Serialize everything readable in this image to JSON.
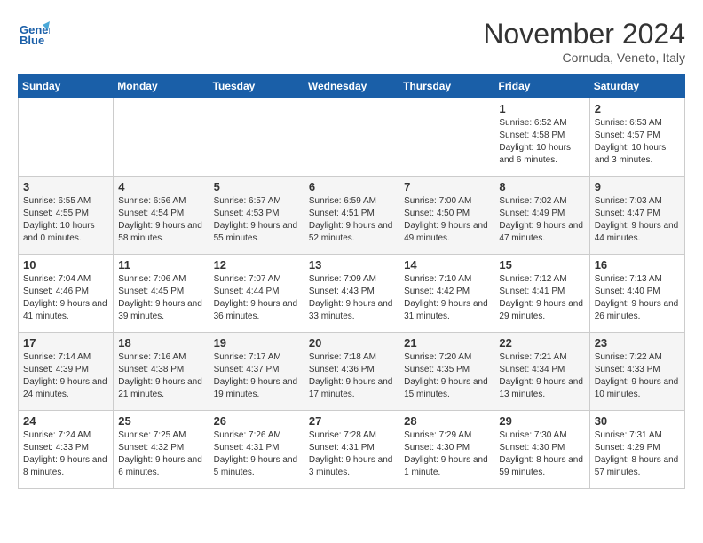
{
  "header": {
    "logo_line1": "General",
    "logo_line2": "Blue",
    "month_title": "November 2024",
    "location": "Cornuda, Veneto, Italy"
  },
  "weekdays": [
    "Sunday",
    "Monday",
    "Tuesday",
    "Wednesday",
    "Thursday",
    "Friday",
    "Saturday"
  ],
  "weeks": [
    [
      {
        "day": "",
        "info": ""
      },
      {
        "day": "",
        "info": ""
      },
      {
        "day": "",
        "info": ""
      },
      {
        "day": "",
        "info": ""
      },
      {
        "day": "",
        "info": ""
      },
      {
        "day": "1",
        "info": "Sunrise: 6:52 AM\nSunset: 4:58 PM\nDaylight: 10 hours and 6 minutes."
      },
      {
        "day": "2",
        "info": "Sunrise: 6:53 AM\nSunset: 4:57 PM\nDaylight: 10 hours and 3 minutes."
      }
    ],
    [
      {
        "day": "3",
        "info": "Sunrise: 6:55 AM\nSunset: 4:55 PM\nDaylight: 10 hours and 0 minutes."
      },
      {
        "day": "4",
        "info": "Sunrise: 6:56 AM\nSunset: 4:54 PM\nDaylight: 9 hours and 58 minutes."
      },
      {
        "day": "5",
        "info": "Sunrise: 6:57 AM\nSunset: 4:53 PM\nDaylight: 9 hours and 55 minutes."
      },
      {
        "day": "6",
        "info": "Sunrise: 6:59 AM\nSunset: 4:51 PM\nDaylight: 9 hours and 52 minutes."
      },
      {
        "day": "7",
        "info": "Sunrise: 7:00 AM\nSunset: 4:50 PM\nDaylight: 9 hours and 49 minutes."
      },
      {
        "day": "8",
        "info": "Sunrise: 7:02 AM\nSunset: 4:49 PM\nDaylight: 9 hours and 47 minutes."
      },
      {
        "day": "9",
        "info": "Sunrise: 7:03 AM\nSunset: 4:47 PM\nDaylight: 9 hours and 44 minutes."
      }
    ],
    [
      {
        "day": "10",
        "info": "Sunrise: 7:04 AM\nSunset: 4:46 PM\nDaylight: 9 hours and 41 minutes."
      },
      {
        "day": "11",
        "info": "Sunrise: 7:06 AM\nSunset: 4:45 PM\nDaylight: 9 hours and 39 minutes."
      },
      {
        "day": "12",
        "info": "Sunrise: 7:07 AM\nSunset: 4:44 PM\nDaylight: 9 hours and 36 minutes."
      },
      {
        "day": "13",
        "info": "Sunrise: 7:09 AM\nSunset: 4:43 PM\nDaylight: 9 hours and 33 minutes."
      },
      {
        "day": "14",
        "info": "Sunrise: 7:10 AM\nSunset: 4:42 PM\nDaylight: 9 hours and 31 minutes."
      },
      {
        "day": "15",
        "info": "Sunrise: 7:12 AM\nSunset: 4:41 PM\nDaylight: 9 hours and 29 minutes."
      },
      {
        "day": "16",
        "info": "Sunrise: 7:13 AM\nSunset: 4:40 PM\nDaylight: 9 hours and 26 minutes."
      }
    ],
    [
      {
        "day": "17",
        "info": "Sunrise: 7:14 AM\nSunset: 4:39 PM\nDaylight: 9 hours and 24 minutes."
      },
      {
        "day": "18",
        "info": "Sunrise: 7:16 AM\nSunset: 4:38 PM\nDaylight: 9 hours and 21 minutes."
      },
      {
        "day": "19",
        "info": "Sunrise: 7:17 AM\nSunset: 4:37 PM\nDaylight: 9 hours and 19 minutes."
      },
      {
        "day": "20",
        "info": "Sunrise: 7:18 AM\nSunset: 4:36 PM\nDaylight: 9 hours and 17 minutes."
      },
      {
        "day": "21",
        "info": "Sunrise: 7:20 AM\nSunset: 4:35 PM\nDaylight: 9 hours and 15 minutes."
      },
      {
        "day": "22",
        "info": "Sunrise: 7:21 AM\nSunset: 4:34 PM\nDaylight: 9 hours and 13 minutes."
      },
      {
        "day": "23",
        "info": "Sunrise: 7:22 AM\nSunset: 4:33 PM\nDaylight: 9 hours and 10 minutes."
      }
    ],
    [
      {
        "day": "24",
        "info": "Sunrise: 7:24 AM\nSunset: 4:33 PM\nDaylight: 9 hours and 8 minutes."
      },
      {
        "day": "25",
        "info": "Sunrise: 7:25 AM\nSunset: 4:32 PM\nDaylight: 9 hours and 6 minutes."
      },
      {
        "day": "26",
        "info": "Sunrise: 7:26 AM\nSunset: 4:31 PM\nDaylight: 9 hours and 5 minutes."
      },
      {
        "day": "27",
        "info": "Sunrise: 7:28 AM\nSunset: 4:31 PM\nDaylight: 9 hours and 3 minutes."
      },
      {
        "day": "28",
        "info": "Sunrise: 7:29 AM\nSunset: 4:30 PM\nDaylight: 9 hours and 1 minute."
      },
      {
        "day": "29",
        "info": "Sunrise: 7:30 AM\nSunset: 4:30 PM\nDaylight: 8 hours and 59 minutes."
      },
      {
        "day": "30",
        "info": "Sunrise: 7:31 AM\nSunset: 4:29 PM\nDaylight: 8 hours and 57 minutes."
      }
    ]
  ]
}
